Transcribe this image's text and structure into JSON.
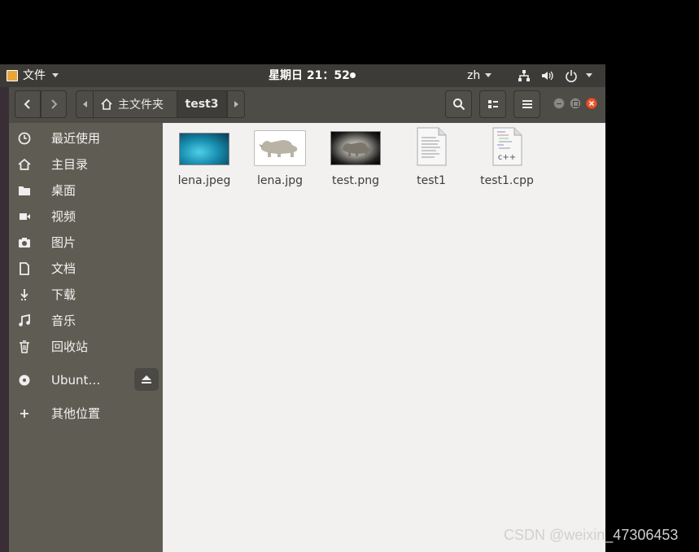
{
  "topbar": {
    "app_menu_label": "文件",
    "clock": "星期日 21：52",
    "lang": "zh"
  },
  "header": {
    "breadcrumb_home": "主文件夹",
    "breadcrumb_current": "test3"
  },
  "sidebar": {
    "items": [
      {
        "label": "最近使用",
        "icon": "clock-icon"
      },
      {
        "label": "主目录",
        "icon": "home-icon"
      },
      {
        "label": "桌面",
        "icon": "folder-icon"
      },
      {
        "label": "视频",
        "icon": "video-icon"
      },
      {
        "label": "图片",
        "icon": "camera-icon"
      },
      {
        "label": "文档",
        "icon": "document-icon"
      },
      {
        "label": "下载",
        "icon": "download-icon"
      },
      {
        "label": "音乐",
        "icon": "music-icon"
      },
      {
        "label": "回收站",
        "icon": "trash-icon"
      }
    ],
    "drive": {
      "label": "Ubunt…",
      "icon": "disc-icon"
    },
    "other": {
      "label": "其他位置",
      "icon": "plus-icon"
    }
  },
  "files": [
    {
      "name": "lena.jpeg",
      "kind": "image-cyan"
    },
    {
      "name": "lena.jpg",
      "kind": "image-rhino"
    },
    {
      "name": "test.png",
      "kind": "image-dark-rhino"
    },
    {
      "name": "test1",
      "kind": "text-document"
    },
    {
      "name": "test1.cpp",
      "kind": "cpp-source"
    }
  ],
  "cpp_badge": "c++",
  "watermark": "CSDN @weixin_47306453",
  "colors": {
    "topbar": "#3c3b37",
    "headerbar": "#4d4c47",
    "sidebar": "#5f5d53",
    "content": "#f2f1f0",
    "close_button": "#e8572c"
  }
}
